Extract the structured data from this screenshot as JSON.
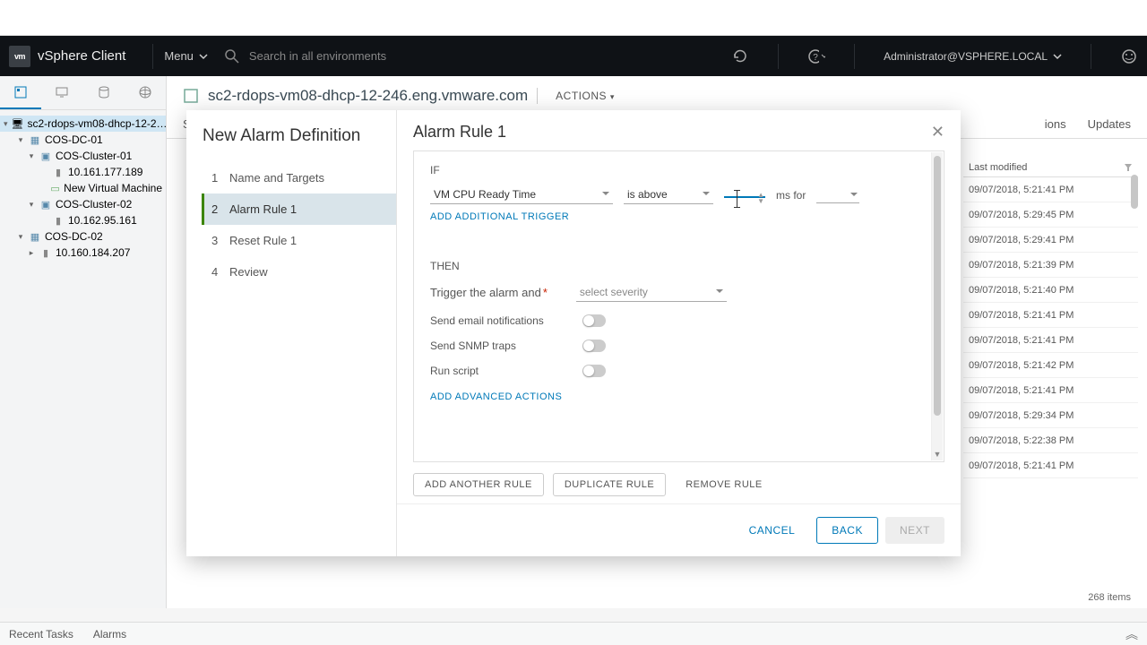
{
  "header": {
    "app_title": "vSphere Client",
    "menu_label": "Menu",
    "search_placeholder": "Search in all environments",
    "user": "Administrator@VSPHERE.LOCAL"
  },
  "tree": {
    "root": "sc2-rdops-vm08-dhcp-12-2…",
    "dc1": "COS-DC-01",
    "cluster1": "COS-Cluster-01",
    "host1": "10.161.177.189",
    "vm1": "New Virtual Machine",
    "cluster2": "COS-Cluster-02",
    "host2": "10.162.95.161",
    "dc2": "COS-DC-02",
    "host3": "10.160.184.207"
  },
  "page": {
    "title": "sc2-rdops-vm08-dhcp-12-246.eng.vmware.com",
    "actions": "ACTIONS",
    "tab_right1": "ions",
    "tab_right2": "Updates",
    "su": "Su"
  },
  "grid": {
    "col_header": "Last modified",
    "rows": [
      "09/07/2018, 5:21:41 PM",
      "09/07/2018, 5:29:45 PM",
      "09/07/2018, 5:29:41 PM",
      "09/07/2018, 5:21:39 PM",
      "09/07/2018, 5:21:40 PM",
      "09/07/2018, 5:21:41 PM",
      "09/07/2018, 5:21:41 PM",
      "09/07/2018, 5:21:42 PM",
      "09/07/2018, 5:21:41 PM",
      "09/07/2018, 5:29:34 PM",
      "09/07/2018, 5:22:38 PM",
      "09/07/2018, 5:21:41 PM"
    ],
    "items": "268 items"
  },
  "modal": {
    "left_title": "New Alarm Definition",
    "steps": {
      "s1": "Name and Targets",
      "s2": "Alarm Rule 1",
      "s3": "Reset Rule 1",
      "s4": "Review"
    },
    "right_title": "Alarm Rule 1",
    "if_label": "IF",
    "trigger_metric": "VM CPU Ready Time",
    "trigger_op": "is above",
    "ms_label": "ms for",
    "add_trigger": "ADD ADDITIONAL TRIGGER",
    "then_label": "THEN",
    "then_text": "Trigger the alarm and",
    "severity_placeholder": "select severity",
    "email_label": "Send email notifications",
    "snmp_label": "Send SNMP traps",
    "script_label": "Run script",
    "add_adv": "ADD ADVANCED ACTIONS",
    "add_rule": "ADD ANOTHER RULE",
    "dup_rule": "DUPLICATE RULE",
    "rem_rule": "REMOVE RULE",
    "cancel": "CANCEL",
    "back": "BACK",
    "next": "NEXT"
  },
  "bottom": {
    "recent": "Recent Tasks",
    "alarms": "Alarms"
  }
}
